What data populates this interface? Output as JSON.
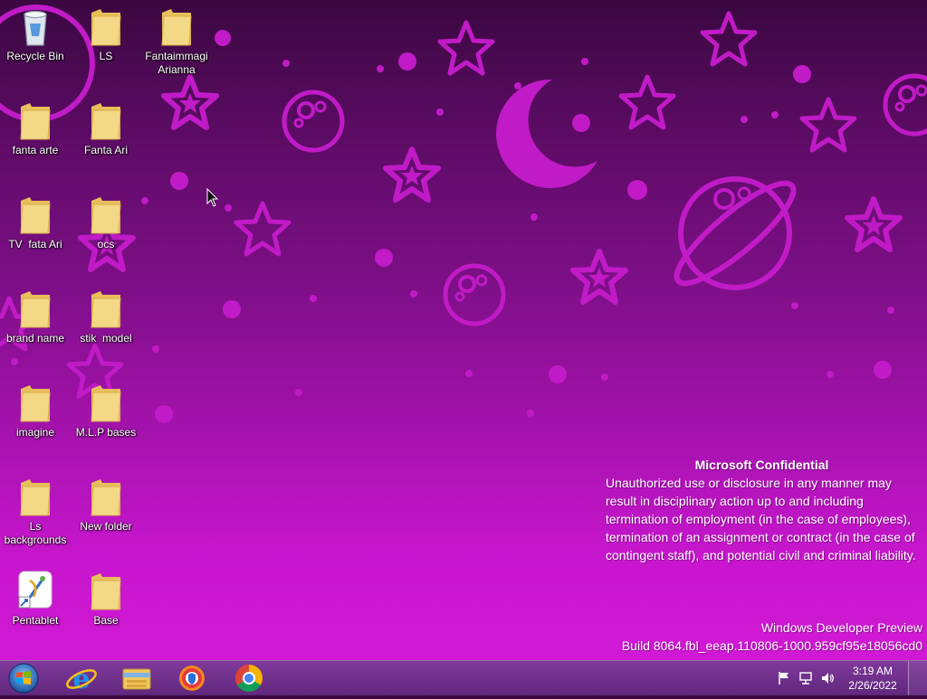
{
  "desktop": {
    "icons": [
      {
        "label": "Recycle Bin",
        "icon": "recycle-bin-icon"
      },
      {
        "label": "LS",
        "icon": "folder-icon"
      },
      {
        "label": "Fantaimmagi Arianna",
        "icon": "folder-icon"
      },
      {
        "label": "fanta arte",
        "icon": "folder-icon"
      },
      {
        "label": "Fanta Ari",
        "icon": "folder-icon"
      },
      {
        "label": "TV  fata Ari",
        "icon": "folder-icon"
      },
      {
        "label": "ocs",
        "icon": "folder-icon"
      },
      {
        "label": "brand name",
        "icon": "folder-icon"
      },
      {
        "label": "stik  model",
        "icon": "folder-icon"
      },
      {
        "label": "imagine",
        "icon": "folder-icon"
      },
      {
        "label": "M.L.P bases",
        "icon": "folder-icon"
      },
      {
        "label": "Ls backgrounds",
        "icon": "folder-icon"
      },
      {
        "label": "New folder",
        "icon": "folder-icon"
      },
      {
        "label": "Pentablet",
        "icon": "pentablet-shortcut-icon"
      },
      {
        "label": "Base",
        "icon": "folder-icon"
      }
    ]
  },
  "watermark": {
    "title": "Microsoft Confidential",
    "body": "Unauthorized use or disclosure in any manner may result in disciplinary action up to and including termination of employment (in the case of employees), termination of an assignment or contract (in the case of contingent staff), and potential civil and criminal liability.",
    "edition": "Windows Developer Preview",
    "build": "Build 8064.fbl_eeap.110806-1000.959cf95e18056cd0"
  },
  "taskbar": {
    "start_icon": "windows-start-icon",
    "pinned": [
      {
        "name": "internet-explorer",
        "icon": "internet-explorer-icon"
      },
      {
        "name": "file-explorer",
        "icon": "file-explorer-icon"
      },
      {
        "name": "browser-shield",
        "icon": "secure-browser-icon"
      },
      {
        "name": "chrome",
        "icon": "chrome-icon"
      }
    ],
    "tray": {
      "icons": [
        "action-center-flag-icon",
        "network-icon",
        "volume-icon"
      ],
      "time": "3:19 AM",
      "date": "2/26/2022"
    }
  },
  "colors": {
    "wallpaper_top": "#3a0840",
    "wallpaper_bottom": "#d41ad8",
    "wallpaper_motif": "#c01bc6",
    "folder_yellow": "#f0d27a"
  }
}
